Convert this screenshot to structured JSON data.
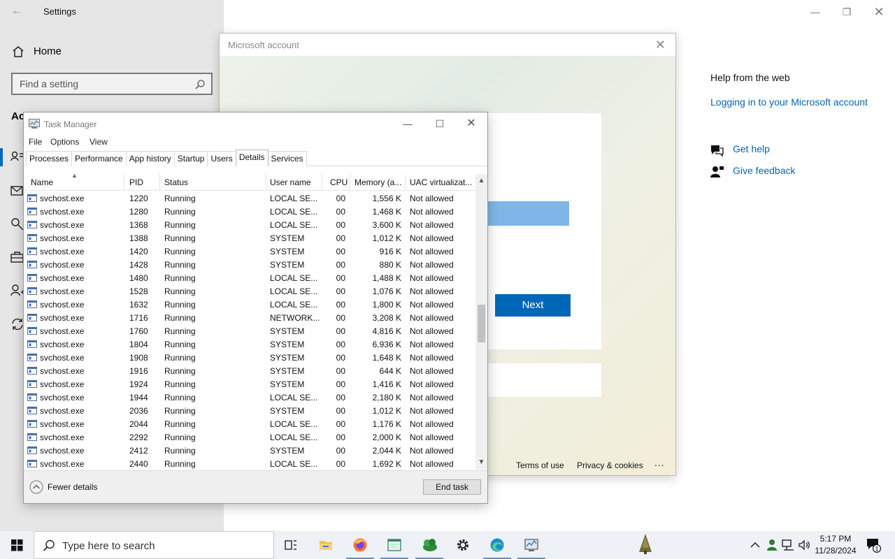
{
  "settings": {
    "title": "Settings",
    "home_label": "Home",
    "search_placeholder": "Find a setting",
    "section_partial": "Ac",
    "help": {
      "heading": "Help from the web",
      "link": "Logging in to your Microsoft account",
      "get_help": "Get help",
      "give_feedback": "Give feedback"
    },
    "nav_icons": [
      "person-card-icon",
      "mail-icon",
      "key-icon",
      "briefcase-icon",
      "person-add-icon",
      "sync-icon"
    ]
  },
  "ms_dialog": {
    "title": "Microsoft account",
    "next_label": "Next",
    "terms_label": "Terms of use",
    "privacy_label": "Privacy & cookies",
    "more_label": "..."
  },
  "task_manager": {
    "title": "Task Manager",
    "menu": [
      "File",
      "Options",
      "View"
    ],
    "tabs": [
      "Processes",
      "Performance",
      "App history",
      "Startup",
      "Users",
      "Details",
      "Services"
    ],
    "active_tab": "Details",
    "columns": {
      "name": "Name",
      "pid": "PID",
      "status": "Status",
      "user": "User name",
      "cpu": "CPU",
      "memory": "Memory (a...",
      "uac": "UAC virtualizat..."
    },
    "rows": [
      {
        "name": "svchost.exe",
        "pid": "1220",
        "status": "Running",
        "user": "LOCAL SE...",
        "cpu": "00",
        "memory": "1,556 K",
        "uac": "Not allowed"
      },
      {
        "name": "svchost.exe",
        "pid": "1280",
        "status": "Running",
        "user": "LOCAL SE...",
        "cpu": "00",
        "memory": "1,468 K",
        "uac": "Not allowed"
      },
      {
        "name": "svchost.exe",
        "pid": "1368",
        "status": "Running",
        "user": "LOCAL SE...",
        "cpu": "00",
        "memory": "3,600 K",
        "uac": "Not allowed"
      },
      {
        "name": "svchost.exe",
        "pid": "1388",
        "status": "Running",
        "user": "SYSTEM",
        "cpu": "00",
        "memory": "1,012 K",
        "uac": "Not allowed"
      },
      {
        "name": "svchost.exe",
        "pid": "1420",
        "status": "Running",
        "user": "SYSTEM",
        "cpu": "00",
        "memory": "916 K",
        "uac": "Not allowed"
      },
      {
        "name": "svchost.exe",
        "pid": "1428",
        "status": "Running",
        "user": "SYSTEM",
        "cpu": "00",
        "memory": "880 K",
        "uac": "Not allowed"
      },
      {
        "name": "svchost.exe",
        "pid": "1480",
        "status": "Running",
        "user": "LOCAL SE...",
        "cpu": "00",
        "memory": "1,488 K",
        "uac": "Not allowed"
      },
      {
        "name": "svchost.exe",
        "pid": "1528",
        "status": "Running",
        "user": "LOCAL SE...",
        "cpu": "00",
        "memory": "1,076 K",
        "uac": "Not allowed"
      },
      {
        "name": "svchost.exe",
        "pid": "1632",
        "status": "Running",
        "user": "LOCAL SE...",
        "cpu": "00",
        "memory": "1,800 K",
        "uac": "Not allowed"
      },
      {
        "name": "svchost.exe",
        "pid": "1716",
        "status": "Running",
        "user": "NETWORK...",
        "cpu": "00",
        "memory": "3,208 K",
        "uac": "Not allowed"
      },
      {
        "name": "svchost.exe",
        "pid": "1760",
        "status": "Running",
        "user": "SYSTEM",
        "cpu": "00",
        "memory": "4,816 K",
        "uac": "Not allowed"
      },
      {
        "name": "svchost.exe",
        "pid": "1804",
        "status": "Running",
        "user": "SYSTEM",
        "cpu": "00",
        "memory": "6,936 K",
        "uac": "Not allowed"
      },
      {
        "name": "svchost.exe",
        "pid": "1908",
        "status": "Running",
        "user": "SYSTEM",
        "cpu": "00",
        "memory": "1,648 K",
        "uac": "Not allowed"
      },
      {
        "name": "svchost.exe",
        "pid": "1916",
        "status": "Running",
        "user": "SYSTEM",
        "cpu": "00",
        "memory": "644 K",
        "uac": "Not allowed"
      },
      {
        "name": "svchost.exe",
        "pid": "1924",
        "status": "Running",
        "user": "SYSTEM",
        "cpu": "00",
        "memory": "1,416 K",
        "uac": "Not allowed"
      },
      {
        "name": "svchost.exe",
        "pid": "1944",
        "status": "Running",
        "user": "LOCAL SE...",
        "cpu": "00",
        "memory": "2,180 K",
        "uac": "Not allowed"
      },
      {
        "name": "svchost.exe",
        "pid": "2036",
        "status": "Running",
        "user": "SYSTEM",
        "cpu": "00",
        "memory": "1,012 K",
        "uac": "Not allowed"
      },
      {
        "name": "svchost.exe",
        "pid": "2044",
        "status": "Running",
        "user": "LOCAL SE...",
        "cpu": "00",
        "memory": "1,176 K",
        "uac": "Not allowed"
      },
      {
        "name": "svchost.exe",
        "pid": "2292",
        "status": "Running",
        "user": "LOCAL SE...",
        "cpu": "00",
        "memory": "2,000 K",
        "uac": "Not allowed"
      },
      {
        "name": "svchost.exe",
        "pid": "2412",
        "status": "Running",
        "user": "SYSTEM",
        "cpu": "00",
        "memory": "2,044 K",
        "uac": "Not allowed"
      },
      {
        "name": "svchost.exe",
        "pid": "2440",
        "status": "Running",
        "user": "LOCAL SE...",
        "cpu": "00",
        "memory": "1,692 K",
        "uac": "Not allowed"
      }
    ],
    "fewer_details": "Fewer details",
    "end_task": "End task"
  },
  "taskbar": {
    "search_placeholder": "Type here to search",
    "apps": [
      "task-view-icon",
      "file-explorer-icon",
      "firefox-icon",
      "notepad-window-icon",
      "game-app-icon",
      "settings-gear-icon",
      "edge-icon",
      "task-manager-icon"
    ],
    "time": "5:17 PM",
    "date": "11/28/2024",
    "notification_count": "1"
  },
  "colors": {
    "accent": "#0067b8",
    "link": "#0066b4",
    "settings_sidebar": "#e6e6e6",
    "taskbar": "#eef2f6"
  }
}
